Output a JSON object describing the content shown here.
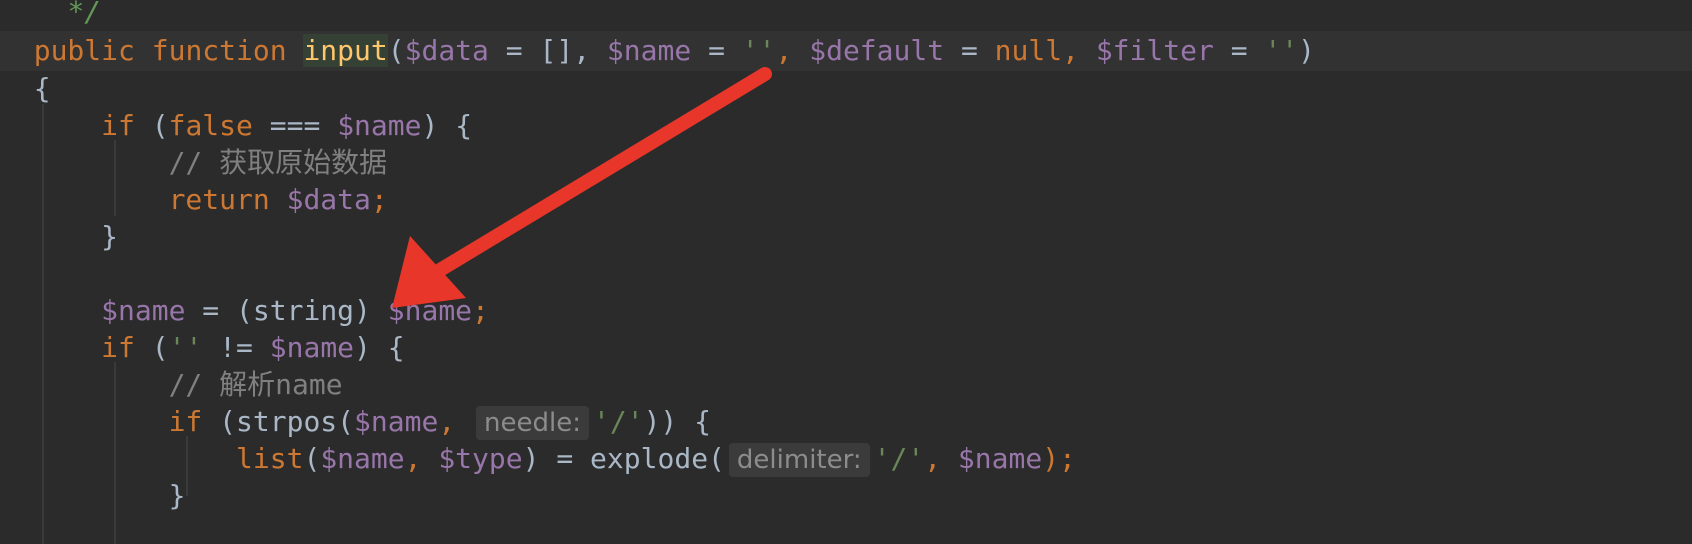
{
  "code": {
    "l0_doc_end": "*/",
    "l1_public": "public",
    "l1_function": "function",
    "l1_name": "input",
    "l1_open": "(",
    "l1_data": "$data",
    "l1_eq1": " = [], ",
    "l1_name_var": "$name",
    "l1_eq2": " = ",
    "l1_str1": "''",
    "l1_comma1": ", ",
    "l1_default": "$default",
    "l1_eq3": " = ",
    "l1_null": "null",
    "l1_comma2": ", ",
    "l1_filter": "$filter",
    "l1_eq4": " = ",
    "l1_str2": "''",
    "l1_close": ")",
    "l2_brace": "{",
    "l3_if": "if",
    "l3_open": " (",
    "l3_false": "false",
    "l3_op": " === ",
    "l3_name": "$name",
    "l3_close": ") {",
    "l4_comment": "// 获取原始数据",
    "l5_return": "return",
    "l5_data": "$data",
    "l5_semi": ";",
    "l6_brace": "}",
    "l8_name": "$name",
    "l8_eq": " = (string) ",
    "l8_name2": "$name",
    "l8_semi": ";",
    "l9_if": "if",
    "l9_open": " (",
    "l9_str": "''",
    "l9_op": " != ",
    "l9_name": "$name",
    "l9_close": ") {",
    "l10_comment": "// 解析name",
    "l11_if": "if",
    "l11_call": " (strpos(",
    "l11_name": "$name",
    "l11_comma": ", ",
    "l11_hint": "needle:",
    "l11_str": "'/'",
    "l11_close": ")) {",
    "l12_list": "list",
    "l12_open": "(",
    "l12_name": "$name",
    "l12_comma": ", ",
    "l12_type": "$type",
    "l12_mid": ") = explode(",
    "l12_hint": "delimiter:",
    "l12_str": "'/'",
    "l12_comma2": ", ",
    "l12_name2": "$name",
    "l12_end": ");",
    "l13_brace": "}"
  },
  "colors": {
    "background": "#2b2b2b",
    "keyword": "#cc7832",
    "variable": "#9876aa",
    "string": "#6a8759",
    "function": "#ffc66d",
    "comment": "#808080",
    "arrow": "#e8372a"
  }
}
